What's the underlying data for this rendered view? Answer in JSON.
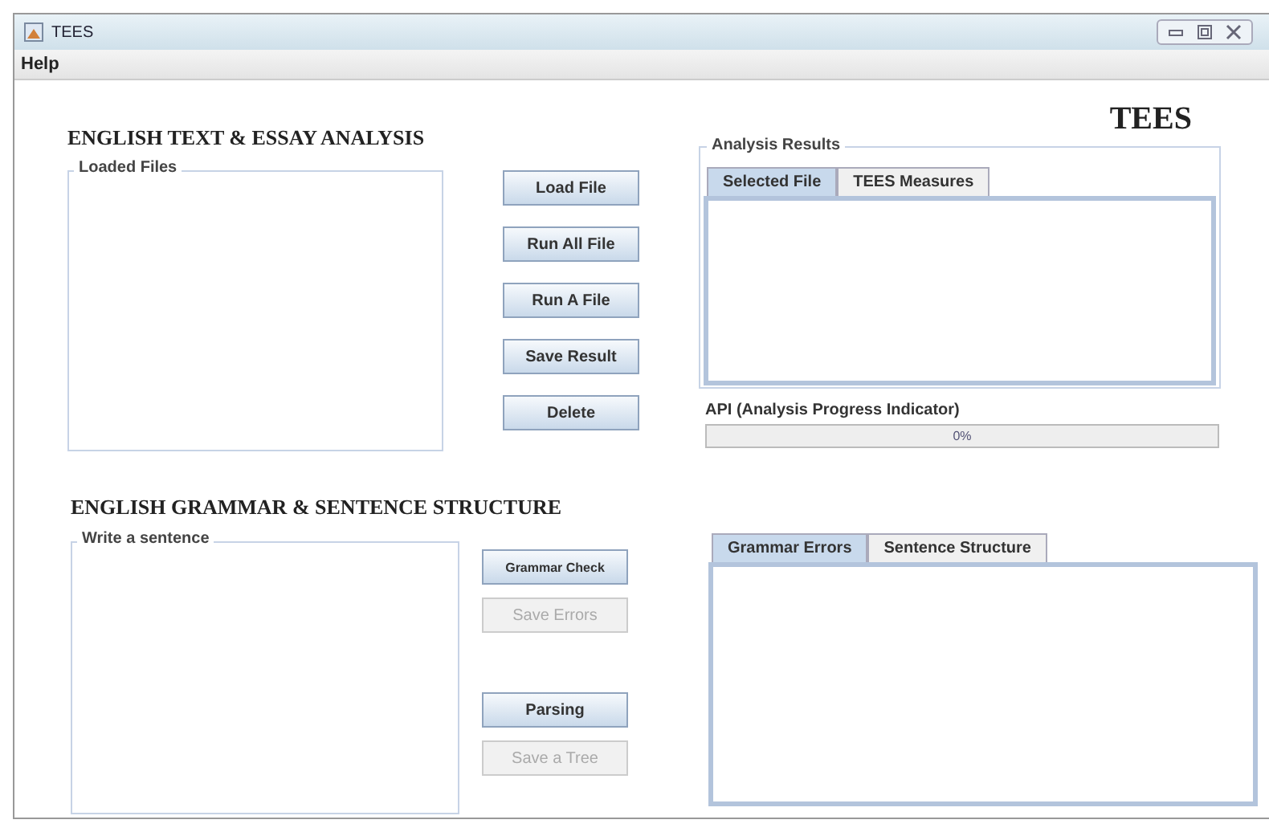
{
  "window": {
    "title": "TEES"
  },
  "menu": [
    "Help"
  ],
  "logo": "TEES",
  "essay": {
    "heading": "ENGLISH TEXT & ESSAY ANALYSIS",
    "files_label": "Loaded Files",
    "buttons": [
      {
        "label": "Load File",
        "disabled": false
      },
      {
        "label": "Run All File",
        "disabled": false
      },
      {
        "label": "Run A File",
        "disabled": false
      },
      {
        "label": "Save Result",
        "disabled": false
      },
      {
        "label": "Delete",
        "disabled": false
      }
    ],
    "results_label": "Analysis Results",
    "tabs": [
      {
        "label": "Selected File",
        "selected": true
      },
      {
        "label": "TEES Measures",
        "selected": false
      }
    ],
    "progress": {
      "label": "API (Analysis Progress Indicator)",
      "level": 0,
      "reading": "0%"
    }
  },
  "grammar": {
    "heading": "ENGLISH GRAMMAR & SENTENCE STRUCTURE",
    "input_label": "Write a sentence",
    "buttons": [
      {
        "label": "Grammar Check",
        "disabled": false,
        "small": true
      },
      {
        "label": "Save Errors",
        "disabled": true,
        "small": false
      },
      {
        "label": "Parsing",
        "disabled": false,
        "small": false
      },
      {
        "label": "Save a Tree",
        "disabled": true,
        "small": false
      }
    ],
    "tabs": [
      {
        "label": "Grammar Errors",
        "selected": true
      },
      {
        "label": "Sentence Structure",
        "selected": false
      }
    ]
  }
}
